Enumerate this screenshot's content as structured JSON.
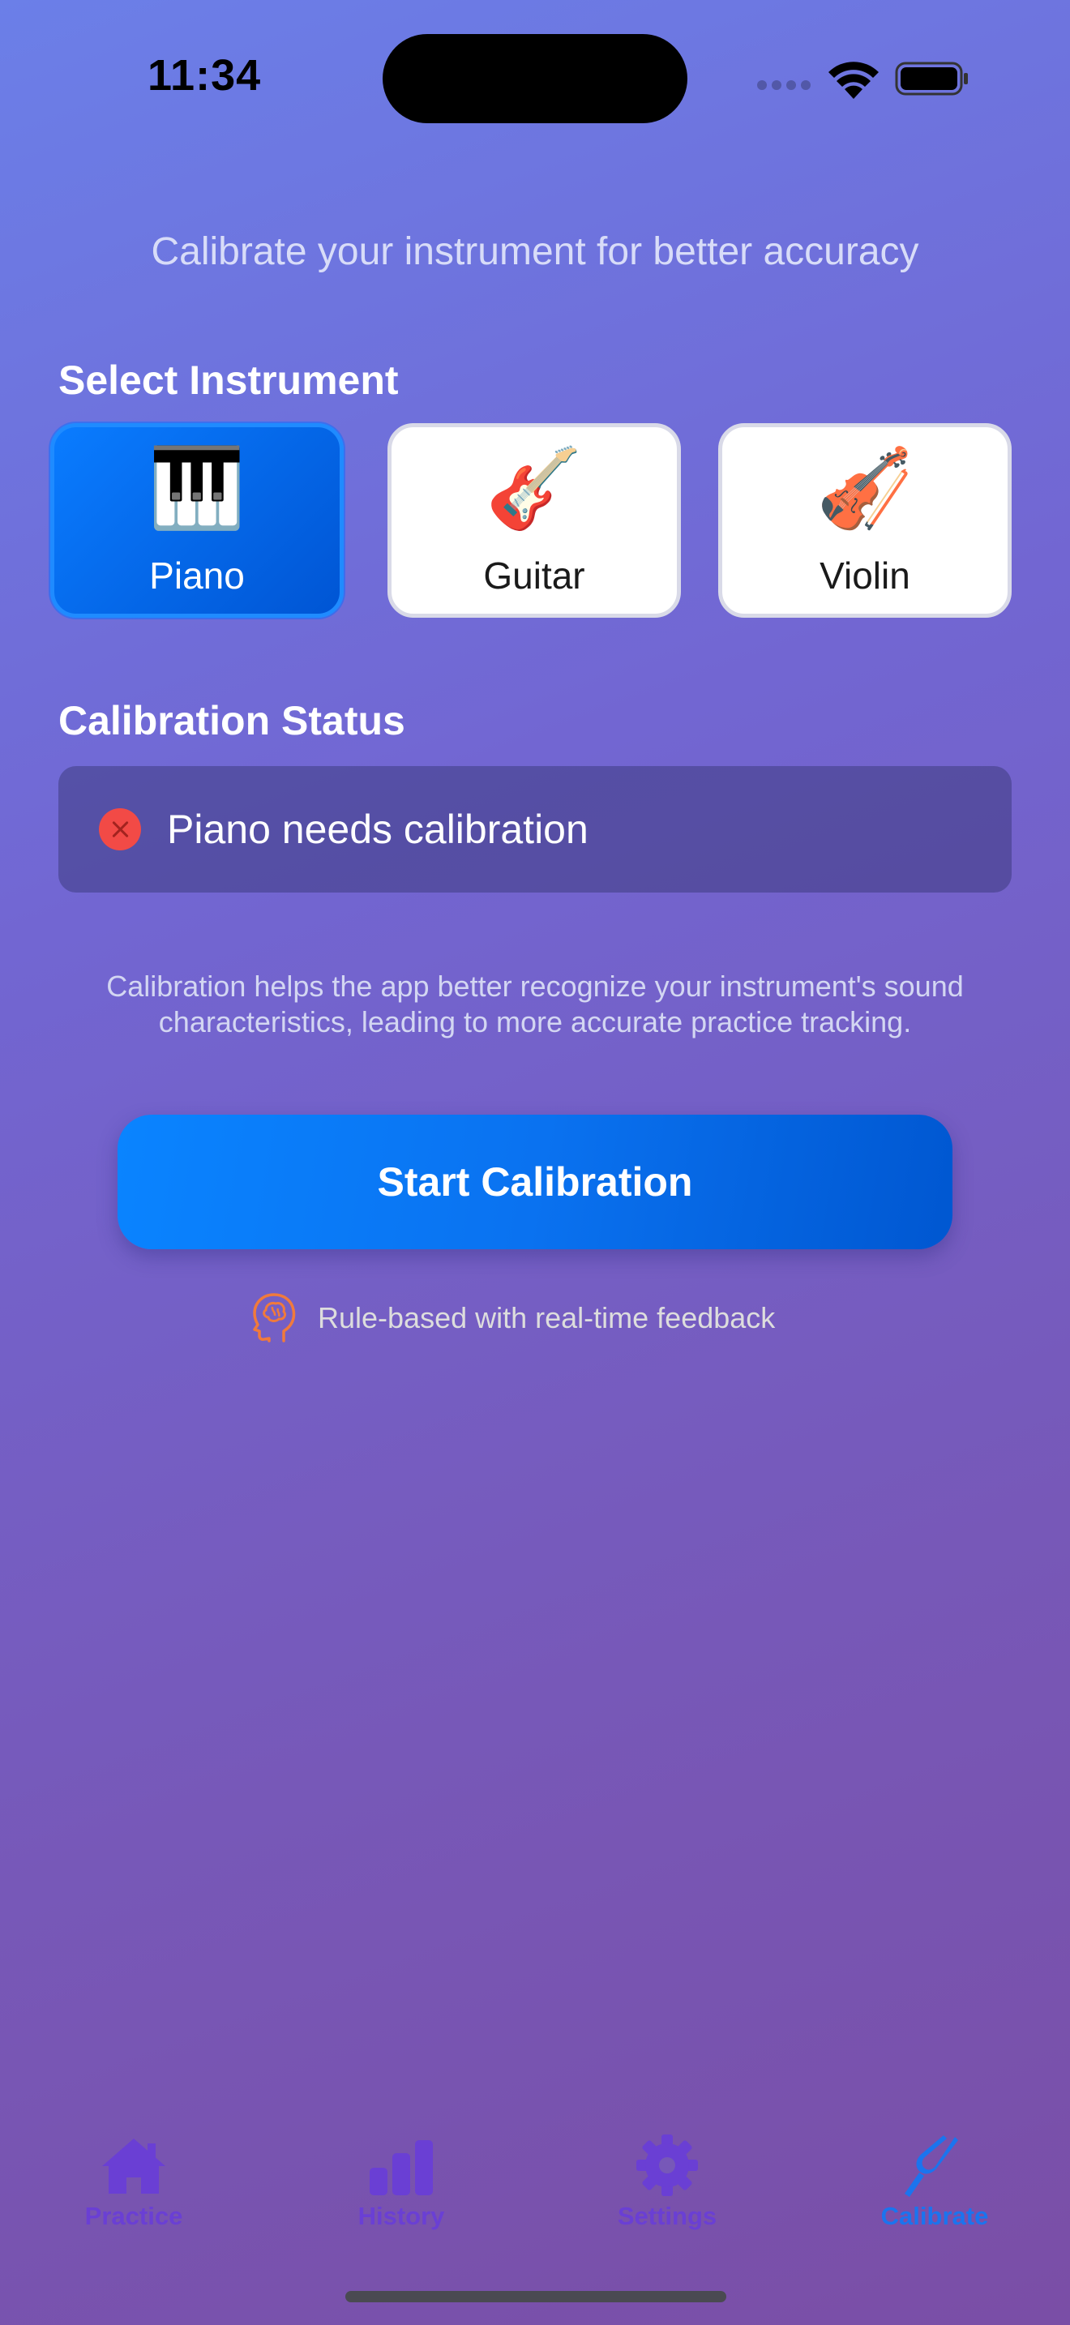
{
  "status_bar": {
    "time": "11:34"
  },
  "subtitle": "Calibrate your instrument for better accuracy",
  "select_instrument": {
    "title": "Select Instrument",
    "options": [
      {
        "label": "Piano",
        "emoji": "🎹",
        "icon": "piano-icon",
        "selected": true
      },
      {
        "label": "Guitar",
        "emoji": "🎸",
        "icon": "guitar-icon",
        "selected": false
      },
      {
        "label": "Violin",
        "emoji": "🎻",
        "icon": "violin-icon",
        "selected": false
      }
    ]
  },
  "calibration_status": {
    "title": "Calibration Status",
    "message": "Piano needs calibration",
    "icon": "x-circle-icon",
    "status_color": "#f24a46"
  },
  "help_text": "Calibration helps the app better recognize your instrument's sound characteristics, leading to more accurate practice tracking.",
  "start_button": {
    "label": "Start Calibration"
  },
  "mode_note": {
    "text": "Rule-based with real-time feedback",
    "icon": "brain-head-icon"
  },
  "tab_bar": {
    "tabs": [
      {
        "label": "Practice",
        "icon": "house-icon",
        "active": false
      },
      {
        "label": "History",
        "icon": "bar-chart-icon",
        "active": false
      },
      {
        "label": "Settings",
        "icon": "gear-icon",
        "active": false
      },
      {
        "label": "Calibrate",
        "icon": "tuning-fork-icon",
        "active": true
      }
    ]
  },
  "colors": {
    "accent": "#0a7cff",
    "tab_active": "#1b74ee",
    "tab_inactive": "#6a3fd4",
    "brain_icon": "#f07a3c"
  }
}
